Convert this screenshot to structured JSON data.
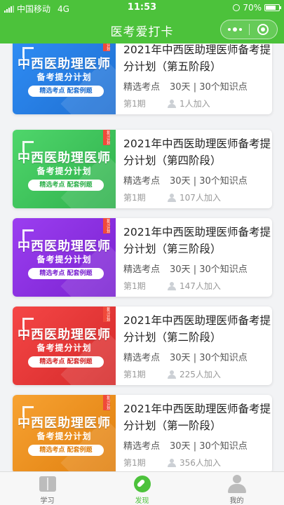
{
  "status_bar": {
    "carrier": "中国移动",
    "network": "4G",
    "time": "11:53",
    "battery": "70%"
  },
  "title_bar": {
    "title": "医考爱打卡",
    "more_icon": "more-dots-icon",
    "close_icon": "capsule-close-icon"
  },
  "cover": {
    "title": "中西医助理医师",
    "subtitle": "备考提分计划",
    "pill": "精选考点 配套例题",
    "tag": "复习计划"
  },
  "cards": [
    {
      "name": "2021年中西医助理医师备考提分计划（第五阶段）",
      "points": "精选考点",
      "days": "30天 | 30个知识点",
      "period": "第1期",
      "joined": "1人加入",
      "color": "#2f8df5",
      "dark": "#1f6fd1"
    },
    {
      "name": "2021年中西医助理医师备考提分计划（第四阶段）",
      "points": "精选考点",
      "days": "30天 | 30个知识点",
      "period": "第1期",
      "joined": "107人加入",
      "color": "#4fd66b",
      "dark": "#2fb04c"
    },
    {
      "name": "2021年中西医助理医师备考提分计划（第三阶段）",
      "points": "精选考点",
      "days": "30天 | 30个知识点",
      "period": "第1期",
      "joined": "147人加入",
      "color": "#9b3ef0",
      "dark": "#7a22d0"
    },
    {
      "name": "2021年中西医助理医师备考提分计划（第二阶段）",
      "points": "精选考点",
      "days": "30天 | 30个知识点",
      "period": "第1期",
      "joined": "225人加入",
      "color": "#f54646",
      "dark": "#d42a2a"
    },
    {
      "name": "2021年中西医助理医师备考提分计划（第一阶段）",
      "points": "精选考点",
      "days": "30天 | 30个知识点",
      "period": "第1期",
      "joined": "356人加入",
      "color": "#f7a232",
      "dark": "#e07f0e"
    }
  ],
  "tabs": [
    {
      "label": "学习",
      "icon": "book-icon",
      "active": false
    },
    {
      "label": "发现",
      "icon": "compass-icon",
      "active": true
    },
    {
      "label": "我的",
      "icon": "profile-icon",
      "active": false
    }
  ],
  "colors": {
    "brand": "#4cc23b"
  }
}
